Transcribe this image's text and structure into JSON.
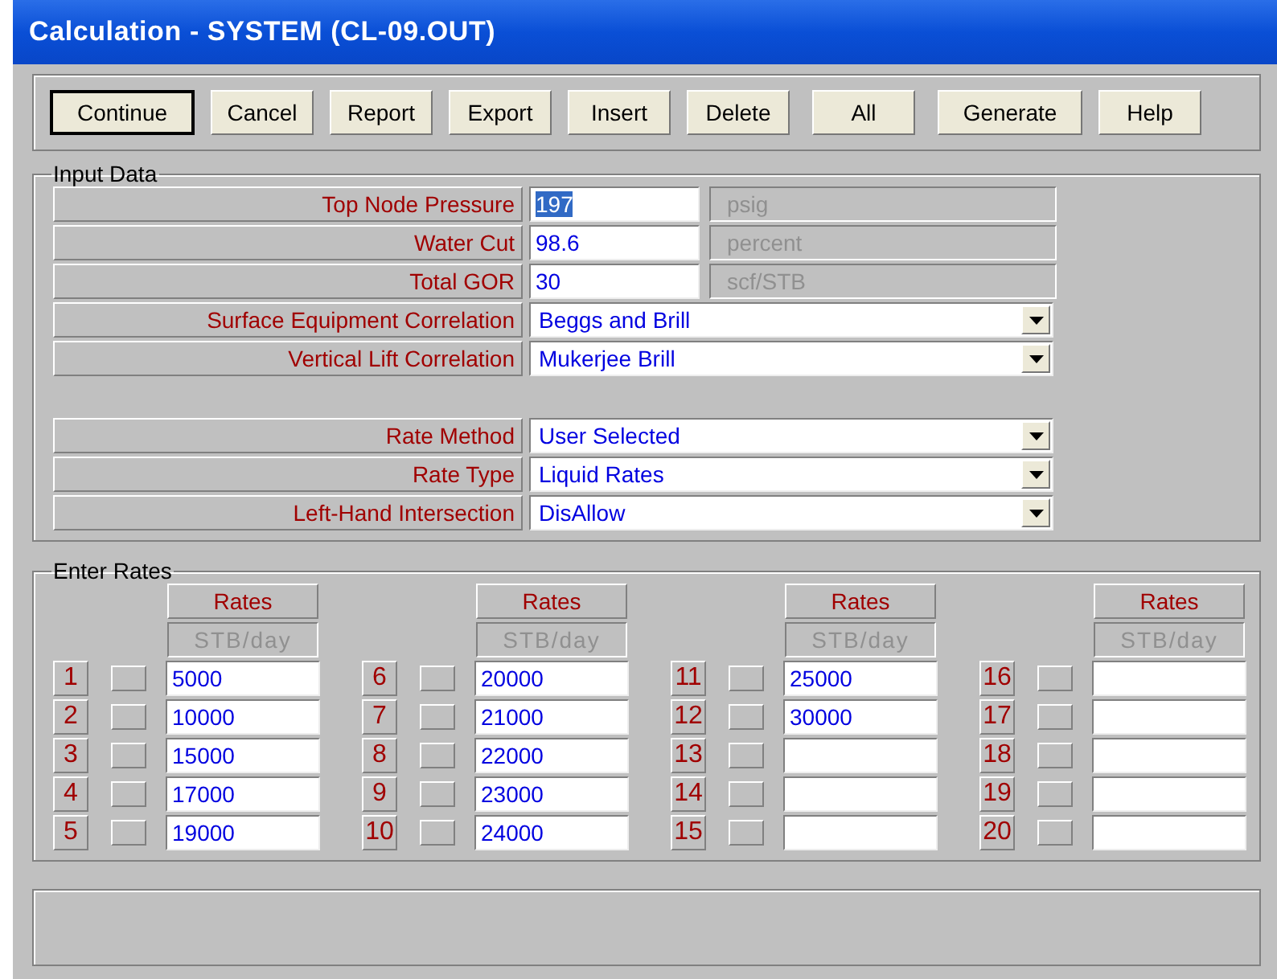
{
  "window": {
    "title": "Calculation - SYSTEM (CL-09.OUT)"
  },
  "buttons": [
    {
      "label": "Continue",
      "default": true
    },
    {
      "label": "Cancel",
      "default": false
    },
    {
      "label": "Report",
      "default": false
    },
    {
      "label": "Export",
      "default": false
    },
    {
      "label": "Insert",
      "default": false
    },
    {
      "label": "Delete",
      "default": false
    },
    {
      "label": "All",
      "default": false
    },
    {
      "label": "Generate",
      "default": false
    },
    {
      "label": "Help",
      "default": false
    }
  ],
  "input_data": {
    "title": "Input Data",
    "groups": [
      [
        {
          "kind": "text",
          "label": "Top Node Pressure",
          "value": "197",
          "text_selected": true,
          "unit": "psig"
        },
        {
          "kind": "text",
          "label": "Water Cut",
          "value": "98.6",
          "text_selected": false,
          "unit": "percent"
        },
        {
          "kind": "text",
          "label": "Total GOR",
          "value": "30",
          "text_selected": false,
          "unit": "scf/STB"
        },
        {
          "kind": "dropdown",
          "label": "Surface Equipment Correlation",
          "value": "Beggs and Brill"
        },
        {
          "kind": "dropdown",
          "label": "Vertical Lift Correlation",
          "value": "Mukerjee Brill"
        }
      ],
      [
        {
          "kind": "dropdown",
          "label": "Rate Method",
          "value": "User Selected"
        },
        {
          "kind": "dropdown",
          "label": "Rate Type",
          "value": "Liquid Rates"
        },
        {
          "kind": "dropdown",
          "label": "Left-Hand Intersection",
          "value": "DisAllow"
        }
      ]
    ]
  },
  "enter_rates": {
    "title": "Enter Rates",
    "columns": [
      {
        "header": "Rates",
        "unit": "STB/day",
        "rows": [
          {
            "number": "1",
            "checked": false,
            "value": "5000"
          },
          {
            "number": "2",
            "checked": false,
            "value": "10000"
          },
          {
            "number": "3",
            "checked": false,
            "value": "15000"
          },
          {
            "number": "4",
            "checked": false,
            "value": "17000"
          },
          {
            "number": "5",
            "checked": false,
            "value": "19000"
          }
        ]
      },
      {
        "header": "Rates",
        "unit": "STB/day",
        "rows": [
          {
            "number": "6",
            "checked": false,
            "value": "20000"
          },
          {
            "number": "7",
            "checked": false,
            "value": "21000"
          },
          {
            "number": "8",
            "checked": false,
            "value": "22000"
          },
          {
            "number": "9",
            "checked": false,
            "value": "23000"
          },
          {
            "number": "10",
            "checked": false,
            "value": "24000"
          }
        ]
      },
      {
        "header": "Rates",
        "unit": "STB/day",
        "rows": [
          {
            "number": "11",
            "checked": false,
            "value": "25000"
          },
          {
            "number": "12",
            "checked": false,
            "value": "30000"
          },
          {
            "number": "13",
            "checked": false
          },
          {
            "number": "14",
            "checked": false
          },
          {
            "number": "15",
            "checked": false
          }
        ]
      },
      {
        "header": "Rates",
        "unit": "STB/day",
        "rows": [
          {
            "number": "16",
            "checked": false
          },
          {
            "number": "17",
            "checked": false
          },
          {
            "number": "18",
            "checked": false
          },
          {
            "number": "19",
            "checked": false
          },
          {
            "number": "20",
            "checked": false
          }
        ]
      }
    ]
  }
}
